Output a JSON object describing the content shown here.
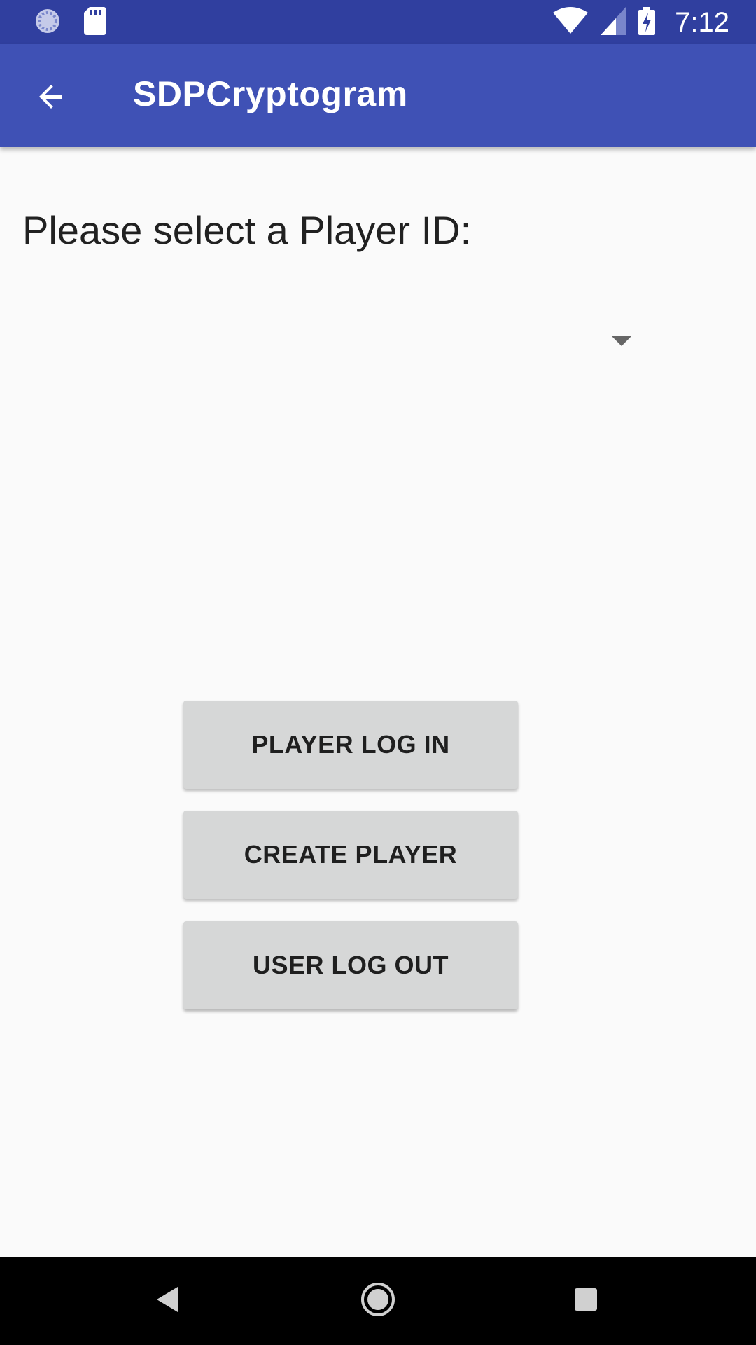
{
  "status_bar": {
    "time": "7:12",
    "icons": [
      "sync-icon",
      "sd-card-icon",
      "wifi-icon",
      "cell-signal-icon",
      "battery-charging-icon"
    ]
  },
  "app_bar": {
    "title": "SDPCryptogram",
    "back_icon": "arrow-back-icon"
  },
  "main": {
    "prompt": "Please select a Player ID:",
    "spinner": {
      "selected_value": "",
      "arrow_icon": "dropdown-arrow-icon"
    },
    "buttons": {
      "player_login": "PLAYER LOG IN",
      "create_player": "CREATE PLAYER",
      "user_logout": "USER LOG OUT"
    }
  },
  "nav_bar": {
    "icons": [
      "nav-back-icon",
      "nav-home-icon",
      "nav-recents-icon"
    ]
  },
  "colors": {
    "status_bar": "#303f9f",
    "app_bar": "#3f51b5",
    "background": "#fafafa",
    "button": "#d6d7d7"
  }
}
